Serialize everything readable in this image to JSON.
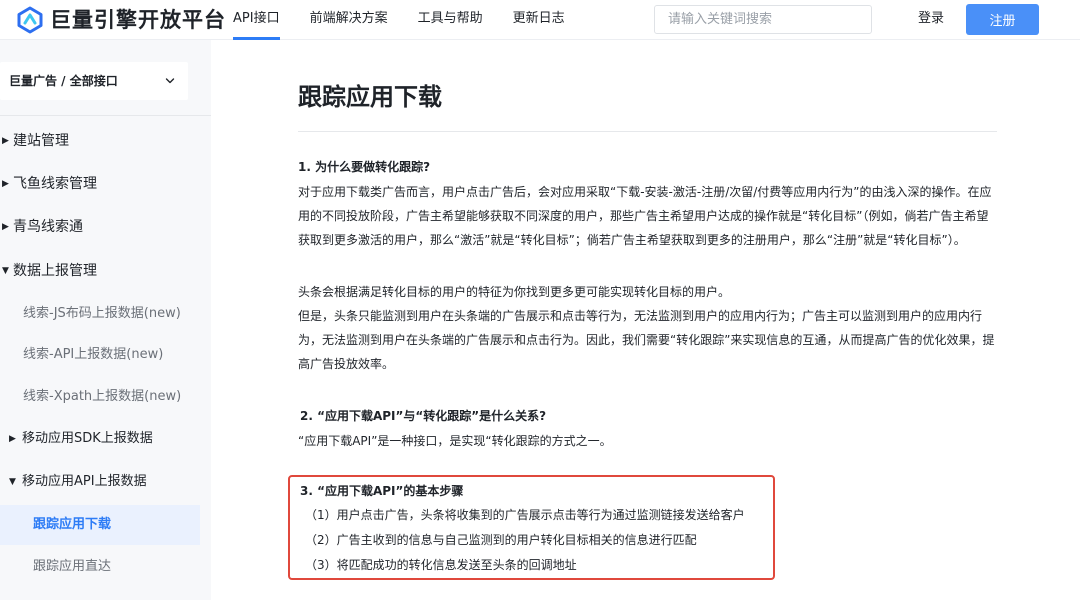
{
  "header": {
    "brand": "巨量引擎开放平台",
    "nav": [
      "API接口",
      "前端解决方案",
      "工具与帮助",
      "更新日志"
    ],
    "search_placeholder": "请输入关键词搜索",
    "login": "登录",
    "register": "注册"
  },
  "sidebar": {
    "selector": "巨量广告 / 全部接口",
    "items": [
      {
        "label": "建站管理"
      },
      {
        "label": "飞鱼线索管理"
      },
      {
        "label": "青鸟线索通"
      },
      {
        "label": "数据上报管理"
      },
      {
        "label": "线索-JS布码上报数据(new)"
      },
      {
        "label": "线索-API上报数据(new)"
      },
      {
        "label": "线索-Xpath上报数据(new)"
      },
      {
        "label": "移动应用SDK上报数据"
      },
      {
        "label": "移动应用API上报数据"
      },
      {
        "label": "跟踪应用下载"
      },
      {
        "label": "跟踪应用直达"
      }
    ]
  },
  "main": {
    "title": "跟踪应用下载",
    "s1": {
      "heading": "1. 为什么要做转化跟踪?",
      "p1": "对于应用下载类广告而言，用户点击广告后，会对应用采取“下载-安装-激活-注册/次留/付费等应用内行为”的由浅入深的操作。在应用的不同投放阶段，广告主希望能够获取不同深度的用户，那些广告主希望用户达成的操作就是“转化目标”（例如，倘若广告主希望获取到更多激活的用户，那么“激活”就是“转化目标”；倘若广告主希望获取到更多的注册用户，那么“注册”就是“转化目标”）。",
      "p2": "头条会根据满足转化目标的用户的特征为你找到更多更可能实现转化目标的用户。",
      "p3": "但是，头条只能监测到用户在头条端的广告展示和点击等行为，无法监测到用户的应用内行为；广告主可以监测到用户的应用内行为，无法监测到用户在头条端的广告展示和点击行为。因此，我们需要“转化跟踪”来实现信息的互通，从而提高广告的优化效果，提高广告投放效率。"
    },
    "s2": {
      "heading": "2. “应用下载API”与“转化跟踪”是什么关系?",
      "p1": "“应用下载API”是一种接口，是实现“转化跟踪的方式之一。"
    },
    "s3": {
      "heading": "3. “应用下载API”的基本步骤",
      "steps": [
        "（1）用户点击广告，头条将收集到的广告展示点击等行为通过监测链接发送给客户",
        "（2）广告主收到的信息与自己监测到的用户转化目标相关的信息进行匹配",
        "（3）将匹配成功的转化信息发送至头条的回调地址"
      ]
    }
  },
  "colors": {
    "accent": "#2d7cf6",
    "register_button": "#4a90f8",
    "highlight_border": "#e0483c",
    "sidebar_bg": "#f7f8fa"
  }
}
